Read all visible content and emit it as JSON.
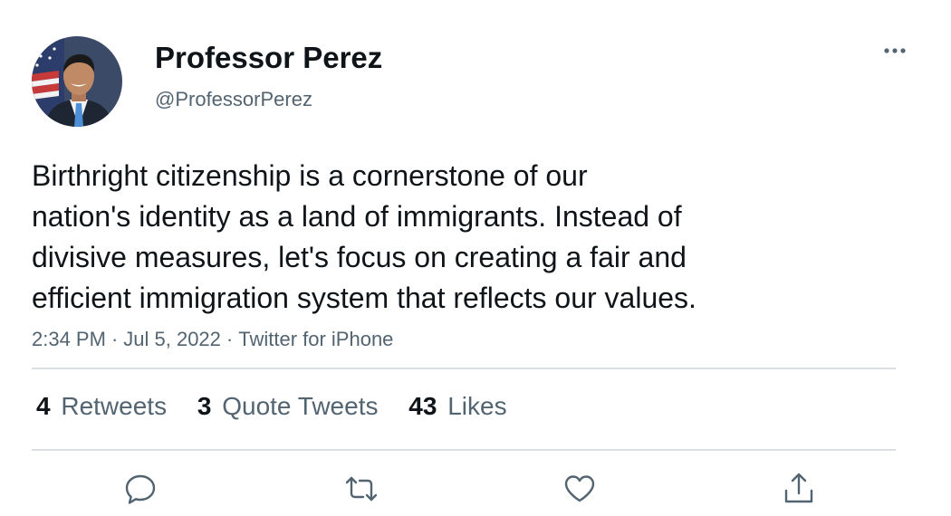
{
  "user": {
    "display_name": "Professor Perez",
    "handle": "@ProfessorPerez",
    "avatar_icon": "profile-photo"
  },
  "tweet": {
    "lines": [
      "Birthright citizenship is a cornerstone of our",
      "nation's identity as a land of immigrants. Instead of",
      "divisive measures, let's focus on creating a fair and",
      "efficient immigration system that reflects our values."
    ],
    "time": "2:34 PM",
    "separator": "·",
    "date": "Jul 5, 2022",
    "source": "Twitter for iPhone"
  },
  "stats": {
    "retweets_count": "4",
    "retweets_label": "Retweets",
    "quotes_count": "3",
    "quotes_label": "Quote Tweets",
    "likes_count": "43",
    "likes_label": "Likes"
  },
  "actions": {
    "reply_icon": "reply-icon",
    "retweet_icon": "retweet-icon",
    "like_icon": "heart-icon",
    "share_icon": "share-icon",
    "more_icon": "more-icon"
  },
  "colors": {
    "text_primary": "#0f1419",
    "text_secondary": "#536471",
    "divider": "#dcdfe2",
    "icon": "#536471"
  }
}
